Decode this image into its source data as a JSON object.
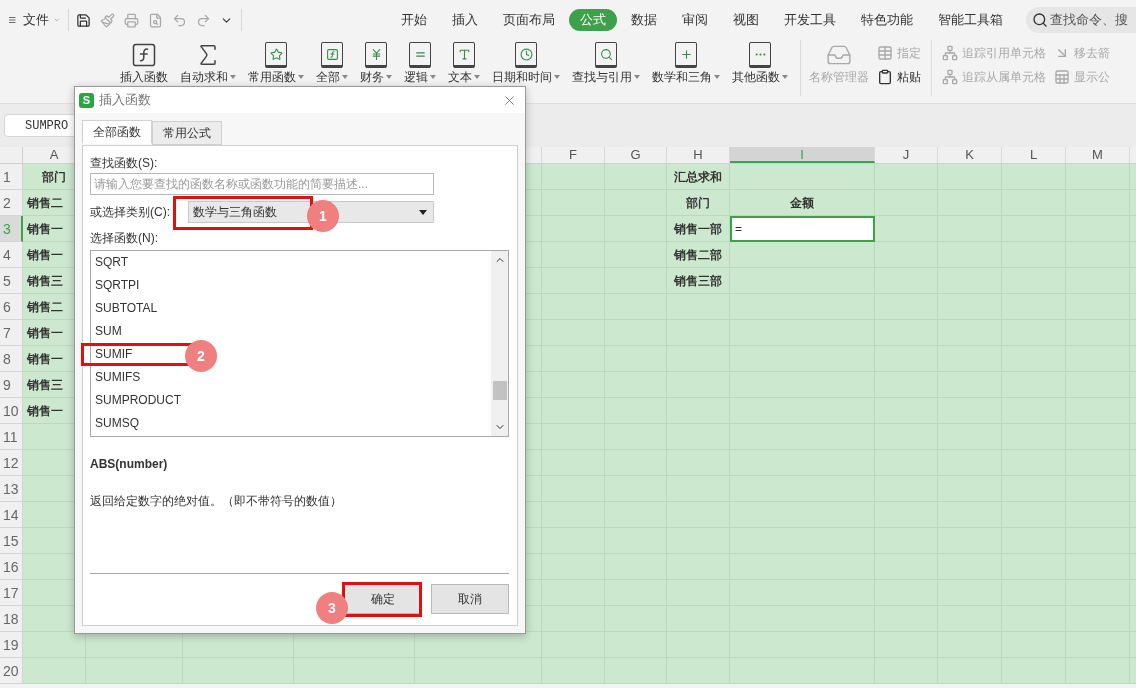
{
  "menu": {
    "label": "文件"
  },
  "tabs": [
    {
      "label": "开始",
      "selected": false
    },
    {
      "label": "插入",
      "selected": false
    },
    {
      "label": "页面布局",
      "selected": false
    },
    {
      "label": "公式",
      "selected": true
    },
    {
      "label": "数据",
      "selected": false
    },
    {
      "label": "审阅",
      "selected": false
    },
    {
      "label": "视图",
      "selected": false
    },
    {
      "label": "开发工具",
      "selected": false
    },
    {
      "label": "特色功能",
      "selected": false
    },
    {
      "label": "智能工具箱",
      "selected": false
    }
  ],
  "search": {
    "placeholder": "查找命令、搜"
  },
  "ribbon": {
    "function_buttons": [
      {
        "label": "插入函数",
        "dropdown": false
      },
      {
        "label": "自动求和",
        "dropdown": true
      },
      {
        "label": "常用函数",
        "dropdown": true
      },
      {
        "label": "全部",
        "dropdown": true
      },
      {
        "label": "财务",
        "dropdown": true
      },
      {
        "label": "逻辑",
        "dropdown": true
      },
      {
        "label": "文本",
        "dropdown": true
      },
      {
        "label": "日期和时间",
        "dropdown": true
      },
      {
        "label": "查找与引用",
        "dropdown": true
      },
      {
        "label": "数学和三角",
        "dropdown": true
      },
      {
        "label": "其他函数",
        "dropdown": true
      }
    ],
    "name_manager": {
      "label": "名称管理器",
      "disabled": true
    },
    "small_buttons": [
      {
        "label": "指定",
        "disabled": true
      },
      {
        "label": "粘贴",
        "disabled": false
      }
    ],
    "audit_buttons": [
      {
        "label": "追踪引用单元格",
        "disabled": true
      },
      {
        "label": "移去箭",
        "disabled": true
      },
      {
        "label": "追踪从属单元格",
        "disabled": true
      },
      {
        "label": "显示公",
        "disabled": true
      }
    ]
  },
  "formula_bar": {
    "name_box": "SUMPRO"
  },
  "sheet": {
    "columns": [
      {
        "label": "A",
        "selected": false
      },
      {
        "label": "F",
        "selected": false
      },
      {
        "label": "G",
        "selected": false
      },
      {
        "label": "H",
        "selected": false
      },
      {
        "label": "I",
        "selected": true
      },
      {
        "label": "J",
        "selected": false
      },
      {
        "label": "K",
        "selected": false
      },
      {
        "label": "L",
        "selected": false
      },
      {
        "label": "M",
        "selected": false
      }
    ],
    "rows": [
      {
        "number": "1",
        "selected": false,
        "col_a": "部门",
        "col_h": "汇总求和"
      },
      {
        "number": "2",
        "selected": false,
        "col_a": "销售二",
        "col_h": "部门",
        "col_i": {
          "text": "金额",
          "active": false
        }
      },
      {
        "number": "3",
        "selected": true,
        "col_a": "销售一",
        "col_h": "销售一部",
        "col_i": {
          "text": "=",
          "active": true
        }
      },
      {
        "number": "4",
        "selected": false,
        "col_a": "销售一",
        "col_h": "销售二部"
      },
      {
        "number": "5",
        "selected": false,
        "col_a": "销售三",
        "col_h": "销售三部"
      },
      {
        "number": "6",
        "selected": false,
        "col_a": "销售二"
      },
      {
        "number": "7",
        "selected": false,
        "col_a": "销售一"
      },
      {
        "number": "8",
        "selected": false,
        "col_a": "销售一"
      },
      {
        "number": "9",
        "selected": false,
        "col_a": "销售三"
      },
      {
        "number": "10",
        "selected": false,
        "col_a": "销售一"
      },
      {
        "number": "11",
        "selected": false
      },
      {
        "number": "12",
        "selected": false
      },
      {
        "number": "13",
        "selected": false
      },
      {
        "number": "14",
        "selected": false
      },
      {
        "number": "15",
        "selected": false
      },
      {
        "number": "16",
        "selected": false
      },
      {
        "number": "17",
        "selected": false
      },
      {
        "number": "18",
        "selected": false
      },
      {
        "number": "19",
        "selected": false
      },
      {
        "number": "20",
        "selected": false
      }
    ]
  },
  "dialog": {
    "logo": "S",
    "title": "插入函数",
    "tabs": [
      {
        "label": "全部函数",
        "selected": true
      },
      {
        "label": "常用公式",
        "selected": false
      }
    ],
    "search": {
      "label": "查找函数(S):",
      "placeholder": "请输入您要查找的函数名称或函数功能的简要描述..."
    },
    "category": {
      "label": "或选择类别(C):",
      "value": "数学与三角函数",
      "annotation": "1"
    },
    "function_list": {
      "label": "选择函数(N):",
      "items": [
        {
          "name": "SQRT",
          "selected": false
        },
        {
          "name": "SQRTPI",
          "selected": false
        },
        {
          "name": "SUBTOTAL",
          "selected": false
        },
        {
          "name": "SUM",
          "selected": false
        },
        {
          "name": "SUMIF",
          "selected": false,
          "annotation": "2"
        },
        {
          "name": "SUMIFS",
          "selected": false
        },
        {
          "name": "SUMPRODUCT",
          "selected": false
        },
        {
          "name": "SUMSQ",
          "selected": false
        }
      ]
    },
    "signature": "ABS(number)",
    "description": "返回给定数字的绝对值。（即不带符号的数值）",
    "buttons": [
      {
        "label": "确定",
        "annotation": "3"
      },
      {
        "label": "取消"
      }
    ]
  }
}
